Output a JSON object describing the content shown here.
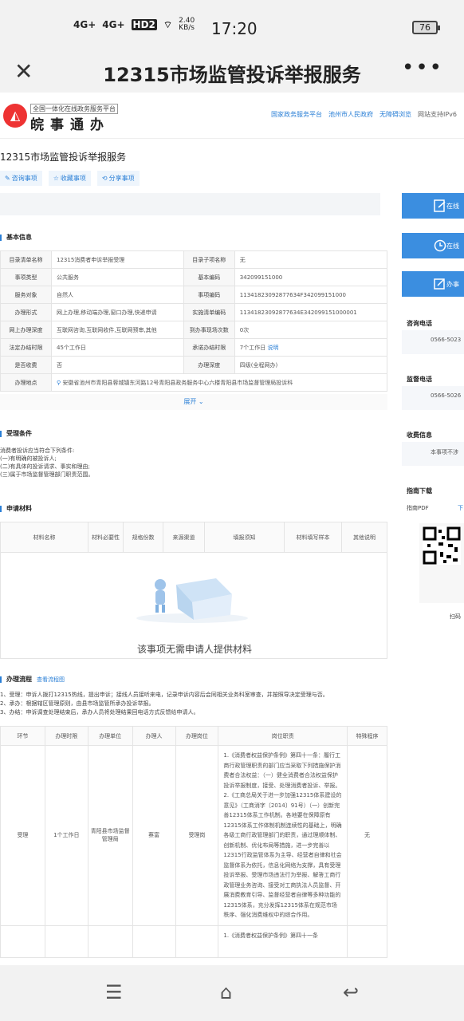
{
  "status_bar": {
    "net1": "4G+",
    "net2": "4G+",
    "hd": "HD2",
    "speed": "2.40 KB/s",
    "time": "17:20",
    "battery": "76"
  },
  "app_bar": {
    "title": "12315市场监管投诉举报服务"
  },
  "site_header": {
    "logo_sub": "全国一体化在线政务服务平台",
    "logo_main": "皖事通办",
    "links": [
      "国家政务服务平台",
      "池州市人民政府",
      "无障碍浏览",
      "网站支持IPv6"
    ]
  },
  "page_title": "12315市场监管投诉举报服务",
  "actions": [
    "咨询事项",
    "收藏事项",
    "分享事项"
  ],
  "basic_info": {
    "heading": "基本信息",
    "rows": [
      [
        "目录清单名称",
        "12315消费者申诉举报受理",
        "目录子项名称",
        "无"
      ],
      [
        "事项类型",
        "公共服务",
        "基本编码",
        "342099151000"
      ],
      [
        "服务对象",
        "自然人",
        "事项编码",
        "11341823092877634F342099151000"
      ],
      [
        "办理形式",
        "网上办理,移动端办理,窗口办理,快递申请",
        "实施清单编码",
        "11341823092877634E342099151000001"
      ],
      [
        "网上办理深度",
        "互联网咨询,互联网收件,互联网预审,其他",
        "到办事现场次数",
        "0次"
      ],
      [
        "法定办结时限",
        "45个工作日",
        "承诺办结时限",
        "7个工作日"
      ],
      [
        "是否收费",
        "否",
        "办理深度",
        "四级(全程网办)"
      ]
    ],
    "explain": "说明",
    "address_label": "办理地点",
    "address": "安徽省池州市青阳县蓉城镇东河路12号青阳县政务服务中心六楼青阳县市场监督管理局投诉科",
    "expand": "展开"
  },
  "conditions": {
    "heading": "受理条件",
    "lines": [
      "消费者投诉应当符合下列条件:",
      "(一)有明确的被投诉人;",
      "(二)有具体的投诉请求、事实和理由;",
      "(三)属于市场监督管理部门职责范围。"
    ]
  },
  "materials": {
    "heading": "申请材料",
    "columns": [
      "材料名称",
      "材料必要性",
      "规格份数",
      "来源渠道",
      "填报须知",
      "材料填写样本",
      "其他说明"
    ],
    "empty": "该事项无需申请人提供材料"
  },
  "process": {
    "heading": "办理流程",
    "view_link": "查看流程图",
    "steps": [
      "1、受理：申诉人拨打12315热线，提出申诉；接线人员接听来电，记录申诉内容后会同相关业务科室审查，并按照导决定受理与否。",
      "2、承办：根据辖区管理原则，由县市场监管所承办投诉举报。",
      "3、办结：申诉调查处理结束后，承办人员将处理结果回电话方式反馈给申请人。"
    ],
    "columns": [
      "环节",
      "办理时限",
      "办理单位",
      "办理人",
      "办理岗位",
      "岗位职责",
      "特殊程序"
    ],
    "row": {
      "stage": "受理",
      "limit": "1个工作日",
      "unit": "青阳县市场监督管理局",
      "person": "蔡富",
      "post": "受理岗",
      "duty": "1.《消费者权益保护条例》第四十一条：履行工商行政管理职责的部门应当采取下列措施保护消费者合法权益：（一）健全消费者合法权益保护投诉举报制度，接受、处理消费者投诉、举报。 2.《工商总局关于进一步加强12315体系建设的意见》（工商消字〔2014〕91号）（一）创新完善12315体系工作机制。各地要在保障原有12315体系工作体制机制连续性的基础上，明确各级工商行政管理部门的职责，通过理顺体制、创新机制、优化布局等措施，进一步完善以12315行政监管体系为主导、经营者自律和社会监督体系为依托，信息化网络为支撑，具有受理投诉举报、受理市场违法行为举报、解答工商行政管理业务咨询、接受对工商执法人员监督、开展消费教育引导、监督经营者自律等多种功能的12315体系，充分发挥12315体系在规范市场秩序、强化消费维权中的综合作用。",
      "special": "无"
    },
    "next_row_hint": "1.《消费者权益保护条例》第四十一条"
  },
  "side_rail": {
    "buttons": [
      "在线",
      "在线",
      "办事"
    ],
    "consult_label": "咨询电话",
    "consult_phone": "0566-5023",
    "supervise_label": "监督电话",
    "supervise_phone": "0566-5026",
    "fee_label": "收费信息",
    "fee_text": "本事项不涉",
    "guide_label": "指南下载",
    "guide_pdf": "指南PDF",
    "guide_dl": "下",
    "scan": "扫码"
  }
}
